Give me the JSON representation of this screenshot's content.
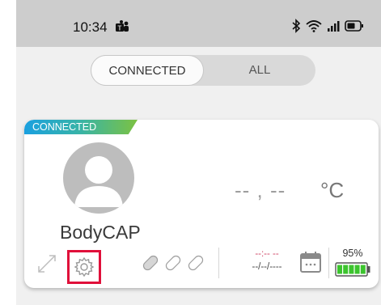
{
  "status_bar": {
    "time": "10:34",
    "app_icon": "teams-icon",
    "icons": [
      "bluetooth-icon",
      "wifi-icon",
      "signal-icon",
      "battery-icon"
    ]
  },
  "tabs": {
    "connected": "CONNECTED",
    "all": "ALL",
    "selected": "CONNECTED"
  },
  "device_card": {
    "status_badge": "CONNECTED",
    "name": "BodyCAP",
    "temperature": "-- , --",
    "unit": "°C",
    "time": "--:-- --",
    "date": "--/--/----",
    "battery_percent": "95%",
    "battery_level": 0.95,
    "icons": [
      "expand-icon",
      "settings-gear-icon",
      "pill-icon",
      "calendar-icon"
    ]
  },
  "colors": {
    "status_bar_bg": "#cdcdcd",
    "highlight_red": "#e0103a",
    "badge_gradient": [
      "#1aa0e0",
      "#39b4a6",
      "#7cc242"
    ],
    "battery_green": "#3cc42e"
  }
}
